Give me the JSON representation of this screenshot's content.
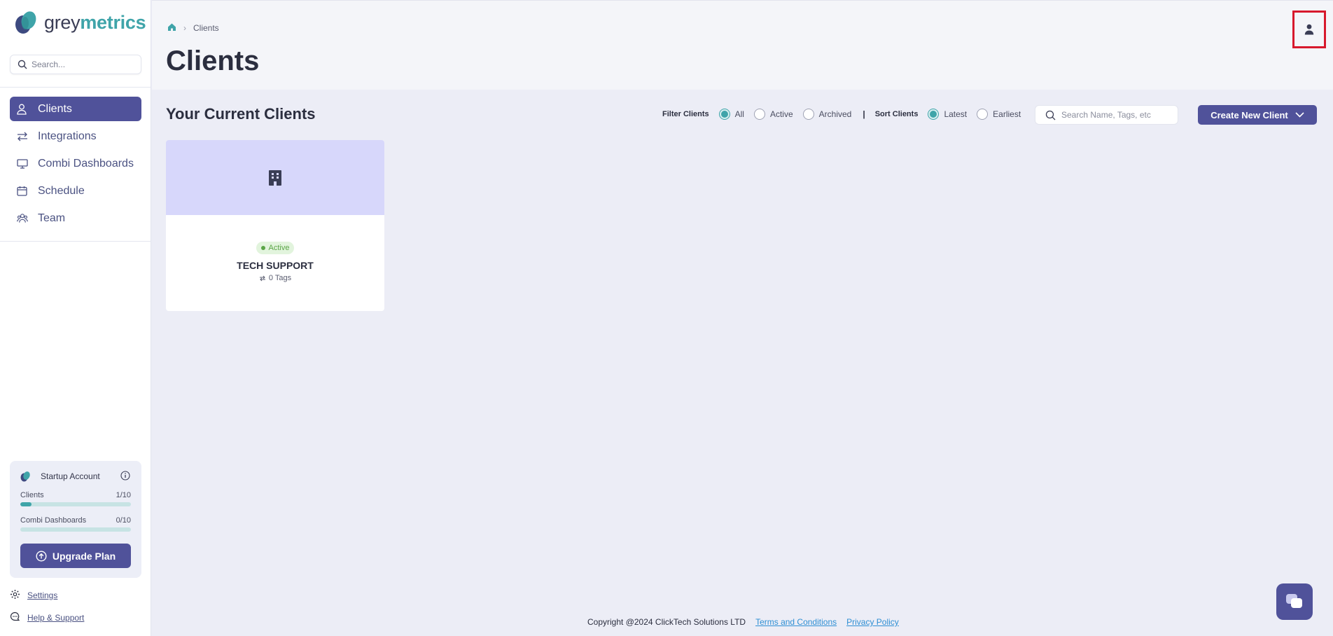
{
  "brand": {
    "name_part1": "grey",
    "name_part2": "metrics",
    "accent": "#3fa4a9",
    "primary": "#50529a"
  },
  "sidebar": {
    "search_placeholder": "Search...",
    "items": [
      {
        "label": "Clients",
        "icon": "user-icon",
        "active": true
      },
      {
        "label": "Integrations",
        "icon": "arrows-icon",
        "active": false
      },
      {
        "label": "Combi Dashboards",
        "icon": "monitor-icon",
        "active": false
      },
      {
        "label": "Schedule",
        "icon": "calendar-icon",
        "active": false
      },
      {
        "label": "Team",
        "icon": "team-icon",
        "active": false
      }
    ],
    "plan": {
      "title": "Startup Account",
      "usage": [
        {
          "label": "Clients",
          "value": "1/10",
          "fraction": 0.1
        },
        {
          "label": "Combi Dashboards",
          "value": "0/10",
          "fraction": 0.0
        }
      ],
      "upgrade_label": "Upgrade Plan"
    },
    "settings_label": "Settings",
    "help_label": "Help & Support"
  },
  "header": {
    "breadcrumb_current": "Clients",
    "title": "Clients"
  },
  "main": {
    "section_title": "Your Current Clients",
    "filter": {
      "label": "Filter Clients",
      "options": [
        "All",
        "Active",
        "Archived"
      ],
      "selected": "All"
    },
    "divider": "|",
    "sort": {
      "label": "Sort Clients",
      "options": [
        "Latest",
        "Earliest"
      ],
      "selected": "Latest"
    },
    "search_placeholder": "Search Name, Tags, etc",
    "create_label": "Create New Client",
    "clients": [
      {
        "status": "Active",
        "name": "TECH SUPPORT",
        "tags": "0 Tags"
      }
    ]
  },
  "footer": {
    "copyright": "Copyright @2024 ClickTech Solutions LTD",
    "terms": "Terms and Conditions",
    "privacy": "Privacy Policy"
  }
}
